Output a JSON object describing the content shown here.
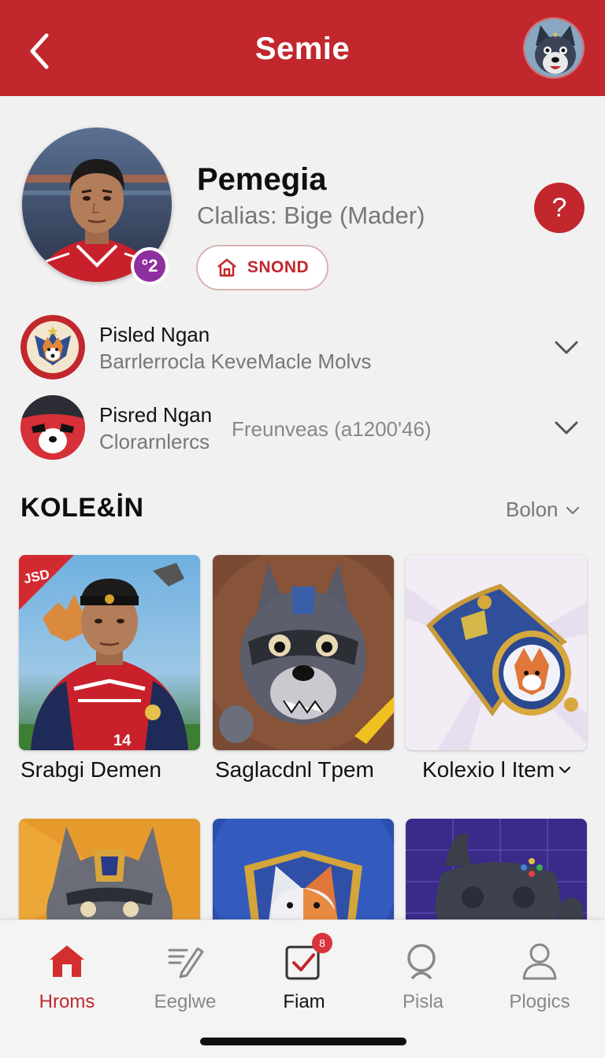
{
  "header": {
    "title": "Semie",
    "back_icon": "chevron-left-icon",
    "avatar_icon": "mascot-avatar-icon"
  },
  "profile": {
    "name": "Pemegia",
    "subtitle": "Clalias: Bige (Mader)",
    "level": "°2",
    "button_label": "SNOND",
    "button_icon": "home-outline-icon",
    "help_icon": "question-icon",
    "help_glyph": "?"
  },
  "rows": [
    {
      "title": "Pisled Ngan",
      "subtitle": "Barrlerrocla KeveMacle Molvs",
      "extra": "",
      "icon": "fox-crest-icon"
    },
    {
      "title": "Pisred Ngan",
      "subtitle": "Clorarnlercs",
      "extra": "Freunveas (a1200'46)",
      "icon": "masked-mascot-icon"
    }
  ],
  "section": {
    "title": "KOLE&İN",
    "filter_label": "Bolon"
  },
  "cards": [
    {
      "label": "Srabgi Demen",
      "badge": "JSD"
    },
    {
      "label": "Saglacdnl Tpem"
    },
    {
      "label": "Kolexio l Item",
      "has_chevron": true
    },
    {
      "label": ""
    },
    {
      "label": ""
    },
    {
      "label": ""
    }
  ],
  "nav": {
    "items": [
      {
        "label": "Hroms",
        "icon": "home-icon"
      },
      {
        "label": "Eeglwe",
        "icon": "edit-icon"
      },
      {
        "label": "Fiam",
        "icon": "checkbox-icon",
        "badge": "8"
      },
      {
        "label": "Pisla",
        "icon": "search-icon"
      },
      {
        "label": "Plogics",
        "icon": "user-icon"
      }
    ]
  },
  "colors": {
    "brand_red": "#c1272d",
    "badge_purple": "#8e2fa0"
  }
}
